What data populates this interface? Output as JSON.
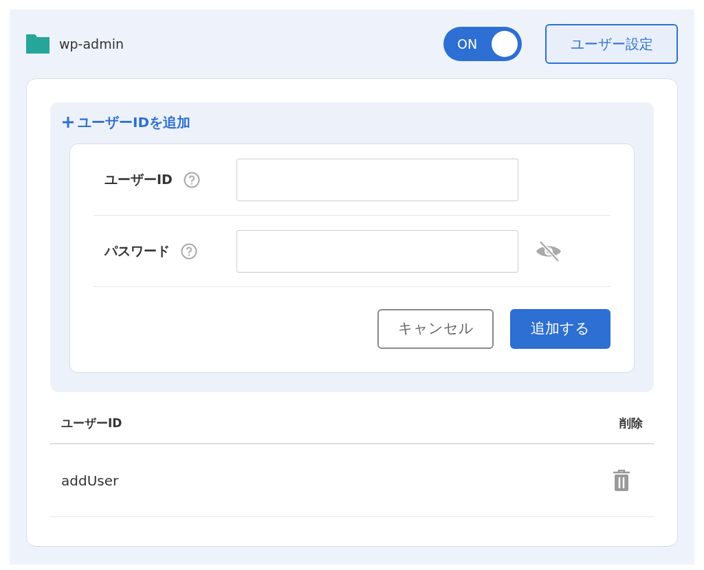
{
  "folder": {
    "name": "wp-admin"
  },
  "toggle": {
    "label": "ON",
    "on": true
  },
  "settings_button": "ユーザー設定",
  "add_section": {
    "title": "ユーザーIDを追加",
    "fields": [
      {
        "label": "ユーザーID",
        "kind": "text"
      },
      {
        "label": "パスワード",
        "kind": "password"
      }
    ],
    "cancel": "キャンセル",
    "submit": "追加する"
  },
  "table": {
    "columns": [
      "ユーザーID",
      "削除"
    ],
    "rows": [
      {
        "user_id": "addUser"
      }
    ]
  }
}
